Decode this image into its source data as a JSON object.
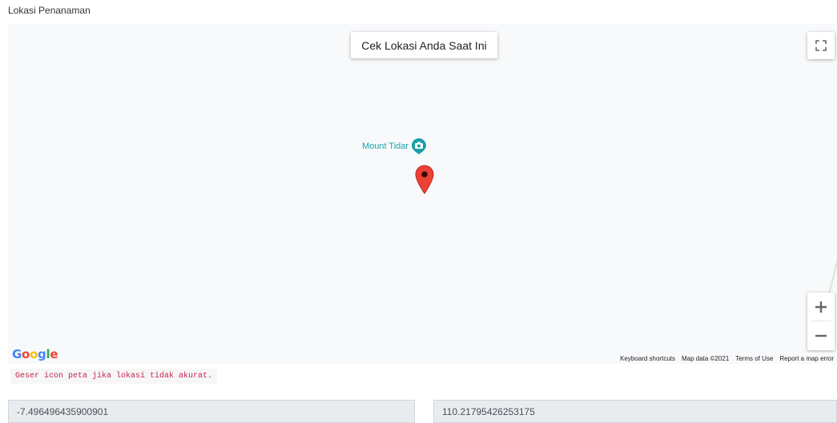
{
  "form": {
    "location_label": "Lokasi Penanaman",
    "hint": "Geser icon peta jika lokasi tidak akurat.",
    "latitude_value": "-7.496496435900901",
    "longitude_value": "110.21795426253175"
  },
  "map": {
    "current_location_button": "Cek Lokasi Anda Saat Ini",
    "poi_label": "Mount Tidar",
    "logo": "Google",
    "attribution": {
      "shortcuts": "Keyboard shortcuts",
      "map_data": "Map data ©2021",
      "terms": "Terms of Use",
      "report": "Report a map error"
    },
    "icons": {
      "fullscreen": "fullscreen-icon",
      "marker": "map-marker-icon",
      "poi": "camera-poi-icon",
      "zoom_in": "plus-icon",
      "zoom_out": "minus-icon"
    },
    "colors": {
      "marker": "#ea4335",
      "poi": "#1a9fa8",
      "hint_text": "#c7254e"
    }
  }
}
